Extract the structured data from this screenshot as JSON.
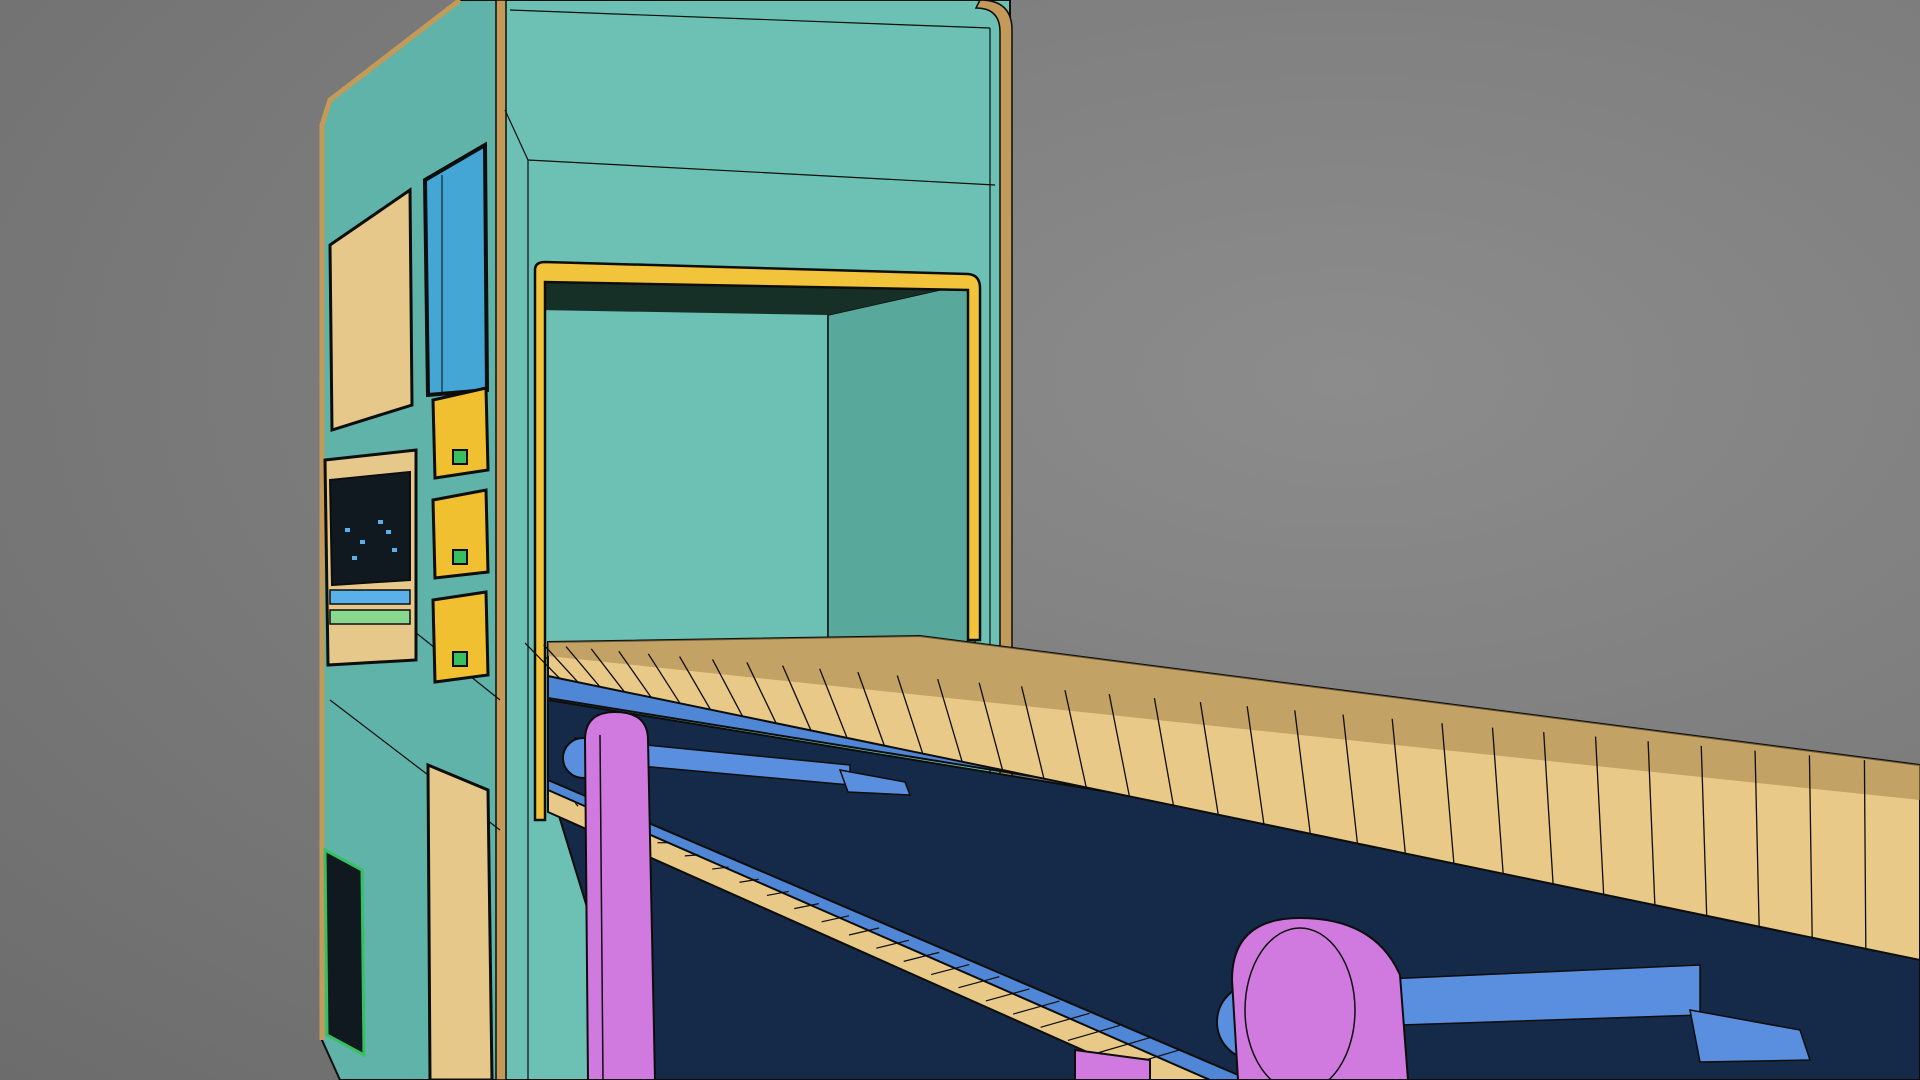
{
  "viewport": {
    "background": "#7f7f7f",
    "render_mode": "shaded-with-wireframe"
  },
  "colors": {
    "machine_body": "#6cc0b4",
    "machine_body_dark": "#58a89c",
    "trim": "#c49a58",
    "panel_fill": "#e6c88a",
    "yellow_fill": "#f0c030",
    "opening_frame": "#f2c43c",
    "belt_dark": "#152a48",
    "belt_rail": "#4f86d6",
    "slat": "#e8c988",
    "slat_shadow": "#a8884e",
    "leg": "#d07ae0",
    "axle": "#5a8fe0",
    "indicator_green": "#36c060",
    "indicator_blue": "#5ab0e8",
    "screen_dark": "#101820",
    "wire": "#0d0d0d"
  },
  "scene": {
    "objects": [
      {
        "name": "scanner-housing",
        "icon": "machine-icon"
      },
      {
        "name": "tunnel-opening",
        "icon": "tunnel-icon"
      },
      {
        "name": "side-window",
        "icon": "window-icon"
      },
      {
        "name": "drawer-panels",
        "icon": "drawer-icon",
        "count": 3
      },
      {
        "name": "control-panel",
        "icon": "control-panel-icon"
      },
      {
        "name": "conveyor-belt",
        "icon": "conveyor-icon"
      },
      {
        "name": "support-legs",
        "icon": "leg-icon",
        "count": 2
      },
      {
        "name": "roller-axles",
        "icon": "roller-icon"
      }
    ],
    "conveyor_slat_count": 34
  }
}
